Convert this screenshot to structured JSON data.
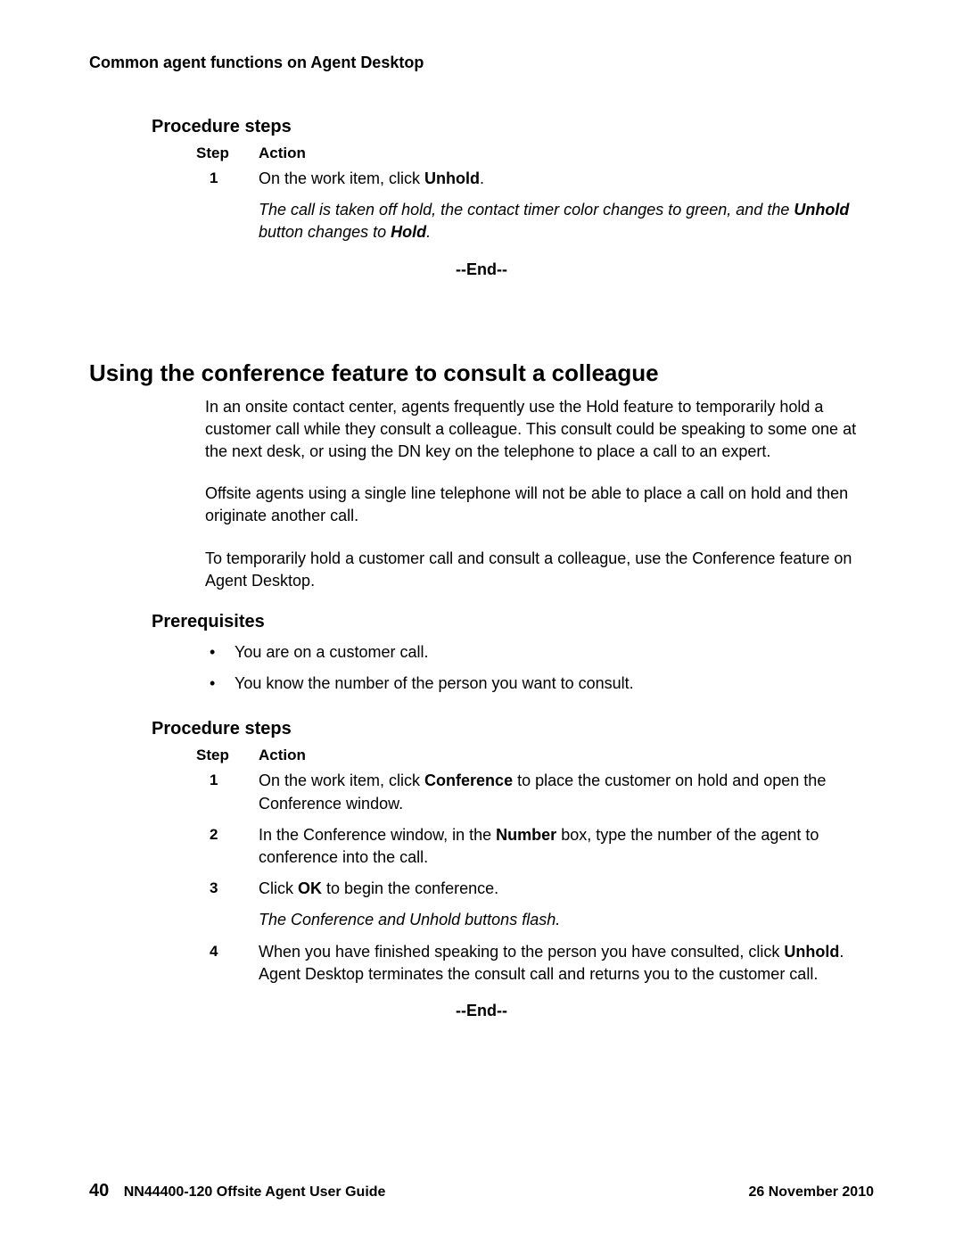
{
  "header": "Common agent functions on Agent Desktop",
  "proc1": {
    "heading": "Procedure steps",
    "stepLabel": "Step",
    "actionLabel": "Action",
    "steps": [
      {
        "num": "1",
        "pre": "On the work item, click ",
        "bold": "Unhold",
        "post": "."
      }
    ],
    "result": {
      "pre": "The call is taken off hold, the contact timer color changes to green, and the ",
      "bold1": "Unhold",
      "mid": " button changes to ",
      "bold2": "Hold",
      "post": "."
    },
    "end": "--End--"
  },
  "section": {
    "heading": "Using the conference feature to consult a colleague",
    "para1": "In an onsite contact center, agents frequently use the Hold feature to temporarily hold a customer call while they consult a colleague. This consult could be speaking to some one at the next desk, or using the DN key on the telephone to place a call to an expert.",
    "para2": "Offsite agents using a single line telephone will not be able to place a call on hold and then originate another call.",
    "para3": "To temporarily hold a customer call and consult a colleague, use the Conference feature on Agent Desktop."
  },
  "prereq": {
    "heading": "Prerequisites",
    "items": [
      "You are on a customer call.",
      "You know the number of the person you want to consult."
    ]
  },
  "proc2": {
    "heading": "Procedure steps",
    "stepLabel": "Step",
    "actionLabel": "Action",
    "step1": {
      "num": "1",
      "pre": "On the work item, click ",
      "bold": "Conference",
      "post": " to place the customer on hold and open the Conference window."
    },
    "step2": {
      "num": "2",
      "pre": "In the Conference window, in the ",
      "bold": "Number",
      "post": " box, type the number of the agent to conference into the call."
    },
    "step3": {
      "num": "3",
      "pre": "Click ",
      "bold": "OK",
      "post": " to begin the conference."
    },
    "result3": "The Conference and Unhold buttons flash.",
    "step4": {
      "num": "4",
      "pre": "When you have finished speaking to the person you have consulted, click ",
      "bold": "Unhold",
      "post": ". Agent Desktop terminates the consult call and returns you to the customer call."
    },
    "end": "--End--"
  },
  "footer": {
    "pageNum": "40",
    "docTitle": "NN44400-120 Offsite Agent User Guide",
    "date": "26 November 2010"
  }
}
